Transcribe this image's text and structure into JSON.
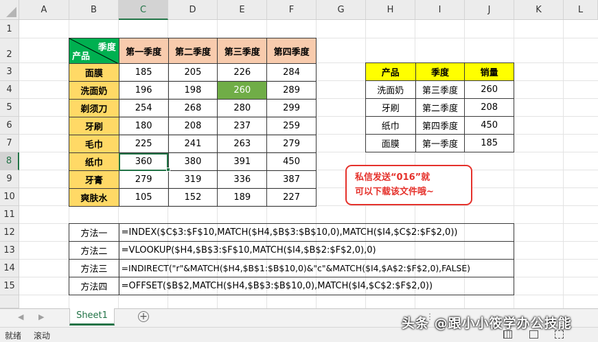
{
  "columns": [
    "A",
    "B",
    "C",
    "D",
    "E",
    "F",
    "G",
    "H",
    "I",
    "J",
    "K",
    "L"
  ],
  "rows": [
    "1",
    "2",
    "3",
    "4",
    "5",
    "6",
    "7",
    "8",
    "9",
    "10",
    "11",
    "12",
    "13",
    "14",
    "15"
  ],
  "sales_table": {
    "header_top": "季度",
    "header_bottom": "产品",
    "quarters": [
      "第一季度",
      "第二季度",
      "第三季度",
      "第四季度"
    ],
    "rows": [
      {
        "product": "面膜",
        "values": [
          "185",
          "205",
          "226",
          "284"
        ]
      },
      {
        "product": "洗面奶",
        "values": [
          "196",
          "198",
          "260",
          "289"
        ]
      },
      {
        "product": "剃须刀",
        "values": [
          "254",
          "268",
          "280",
          "299"
        ]
      },
      {
        "product": "牙刷",
        "values": [
          "180",
          "208",
          "237",
          "259"
        ]
      },
      {
        "product": "毛巾",
        "values": [
          "225",
          "241",
          "263",
          "279"
        ]
      },
      {
        "product": "纸巾",
        "values": [
          "360",
          "380",
          "391",
          "450"
        ]
      },
      {
        "product": "牙膏",
        "values": [
          "279",
          "319",
          "336",
          "387"
        ]
      },
      {
        "product": "爽肤水",
        "values": [
          "105",
          "152",
          "189",
          "227"
        ]
      }
    ]
  },
  "lookup_table": {
    "headers": [
      "产品",
      "季度",
      "销量"
    ],
    "rows": [
      [
        "洗面奶",
        "第三季度",
        "260"
      ],
      [
        "牙刷",
        "第二季度",
        "208"
      ],
      [
        "纸巾",
        "第四季度",
        "450"
      ],
      [
        "面膜",
        "第一季度",
        "185"
      ]
    ]
  },
  "note": {
    "line1": "私信发送“016”就",
    "line2": "可以下载该文件哦~"
  },
  "methods": [
    {
      "name": "方法一",
      "formula": "=INDEX($C$3:$F$10,MATCH($H4,$B$3:$B$10,0),MATCH($I4,$C$2:$F$2,0))"
    },
    {
      "name": "方法二",
      "formula": "=VLOOKUP($H4,$B$3:$F$10,MATCH($I4,$B$2:$F$2,0),0)"
    },
    {
      "name": "方法三",
      "formula": "=INDIRECT(\"r\"&MATCH($H4,$B$1:$B$10,0)&\"c\"&MATCH($I4,$A$2:$F$2,0),FALSE)"
    },
    {
      "name": "方法四",
      "formula": "=OFFSET($B$2,MATCH($H4,$B$3:$B$10,0),MATCH($I4,$C$2:$F$2,0))"
    }
  ],
  "sheet_tab": "Sheet1",
  "status": {
    "ready": "就绪",
    "scroll": "滚动"
  },
  "watermark": "头条 @跟小小筱学办公技能",
  "colors": {
    "header_fill": "#f8cbad",
    "row_label_fill": "#ffd966",
    "highlight": "#70ad47",
    "lookup_header": "#ffff00",
    "diag_fill": "#00b050",
    "note_border": "#e5312b",
    "excel_green": "#217346"
  }
}
